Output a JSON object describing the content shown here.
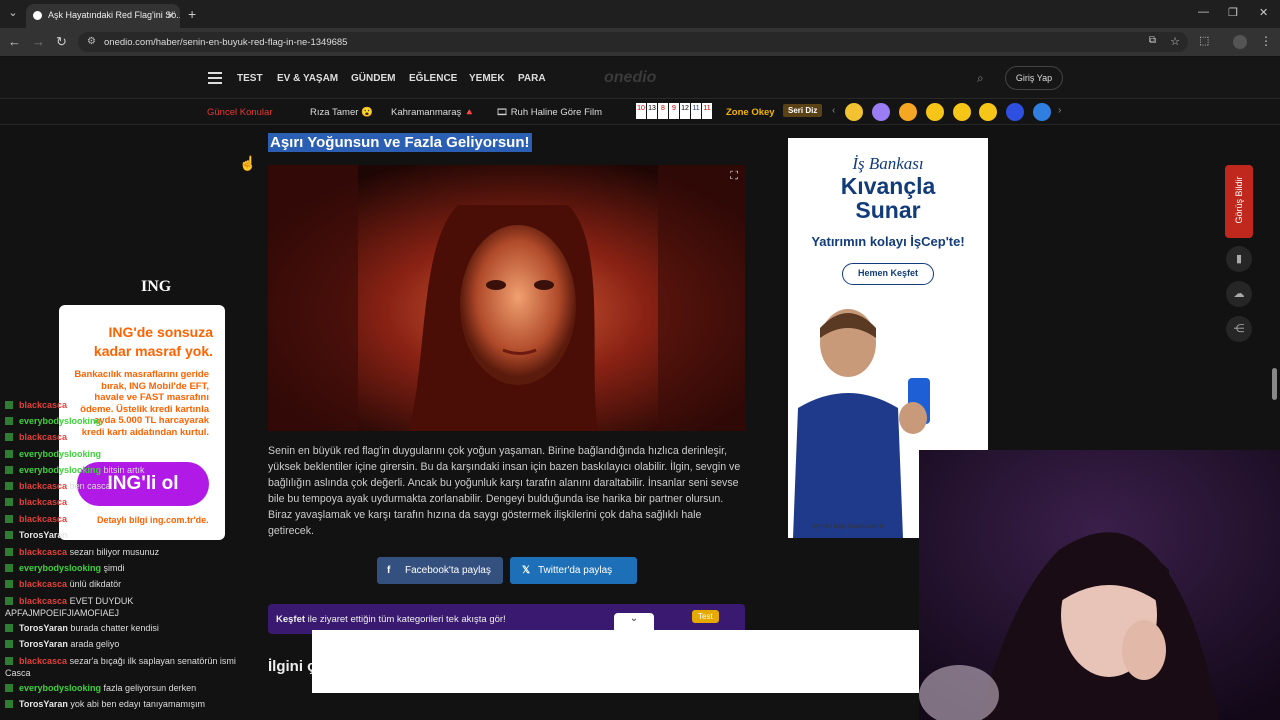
{
  "browser": {
    "tab_title": "Aşk Hayatındaki Red Flag'ini Sö...",
    "url": "onedio.com/haber/senin-en-buyuk-red-flag-in-ne-1349685"
  },
  "header": {
    "nav": [
      "TEST",
      "EV & YAŞAM",
      "GÜNDEM",
      "EĞLENCE",
      "YEMEK",
      "PARA"
    ],
    "logo": "onedio",
    "login": "Giriş Yap"
  },
  "subnav": {
    "items": [
      "Güncel Konular",
      "Rıza Tamer 😮",
      "Kahramanmaraş 🔺",
      "🎞 Ruh Haline Göre Film"
    ],
    "zone": "Zone Okey",
    "seri": "Seri Diz",
    "tiles": [
      "10",
      "13",
      "8",
      "9",
      "12",
      "11",
      "11"
    ]
  },
  "article": {
    "headline": "Aşırı Yoğunsun ve Fazla Geliyorsun!",
    "body": "Senin en büyük red flag'in duygularını çok yoğun yaşaman. Birine bağlandığında hızlıca derinleşir, yüksek beklentiler içine girersin. Bu da karşındaki insan için bazen baskılayıcı olabilir. İlgin, sevgin ve bağlılığın aslında çok değerli. Ancak bu yoğunluk karşı tarafın alanını daraltabilir. İnsanlar seni sevse bile bu tempoya ayak uydurmakta zorlanabilir. Dengeyi bulduğunda ise harika bir partner olursun. Biraz yavaşlamak ve karşı tarafın hızına da saygı göstermek ilişkilerini çok daha sağlıklı hale getirecek.",
    "share_facebook": "Facebook'ta paylaş",
    "share_twitter": "Twitter'da paylaş",
    "kesfet_bold": "Keşfet",
    "kesfet_text": " ile ziyaret ettiğin tüm kategorileri tek akışta gör!",
    "test_badge": "Test",
    "related": "İlgini ç"
  },
  "right_ad": {
    "brand": "İş Bankası",
    "line1": "Kıvançla",
    "line2": "Sunar",
    "slogan": "Yatırımın kolayı İşCep'te!",
    "cta": "Hemen Keşfet",
    "footer": "Ayrıntılı bilgi: isbank.com.tr"
  },
  "left_ad": {
    "brand": "ING",
    "title": "ING'de sonsuza kadar masraf yok.",
    "body": "Bankacılık masraflarını geride bırak, ING Mobil'de EFT, havale ve FAST masrafını ödeme. Üstelik kredi kartınla ayda 5.000 TL harcayarak kredi kartı aidatından kurtul.",
    "cta": "ING'li ol",
    "footer": "Detaylı bilgi ing.com.tr'de."
  },
  "side_feedback": "Görüş Bildir",
  "chat": [
    {
      "user": "blackcasca",
      "msg": "",
      "color": "#e0413c"
    },
    {
      "user": "everybodyslooking",
      "msg": "",
      "color": "#3ed13b"
    },
    {
      "user": "blackcasca",
      "msg": "",
      "color": "#e0413c"
    },
    {
      "user": "everybodyslooking",
      "msg": "",
      "color": "#3ed13b"
    },
    {
      "user": "everybodyslooking",
      "msg": "bitsin artık",
      "color": "#3ed13b"
    },
    {
      "user": "blackcasca",
      "msg": "ben casca",
      "color": "#e0413c"
    },
    {
      "user": "blackcasca",
      "msg": "",
      "color": "#e0413c"
    },
    {
      "user": "blackcasca",
      "msg": "",
      "color": "#e0413c"
    },
    {
      "user": "TorosYaran",
      "msg": "",
      "color": "#e8e8e8"
    },
    {
      "user": "blackcasca",
      "msg": "sezarı biliyor musunuz",
      "color": "#e0413c"
    },
    {
      "user": "everybodyslooking",
      "msg": "şimdi",
      "color": "#3ed13b"
    },
    {
      "user": "blackcasca",
      "msg": "ünlü dikdatör",
      "color": "#e0413c"
    },
    {
      "user": "blackcasca",
      "msg": "EVET DUYDUK APFAJMPOEIFJIAMOFIAEJ",
      "color": "#e0413c"
    },
    {
      "user": "TorosYaran",
      "msg": "burada chatter kendisi",
      "color": "#e8e8e8"
    },
    {
      "user": "TorosYaran",
      "msg": "arada geliyo",
      "color": "#e8e8e8"
    },
    {
      "user": "blackcasca",
      "msg": "sezar'a bıçağı ilk saplayan senatörün ismi Casca",
      "color": "#e0413c"
    },
    {
      "user": "everybodyslooking",
      "msg": "fazla geliyorsun derken",
      "color": "#3ed13b"
    },
    {
      "user": "TorosYaran",
      "msg": "yok abi ben edayı tanıyamamışım",
      "color": "#e8e8e8"
    }
  ]
}
